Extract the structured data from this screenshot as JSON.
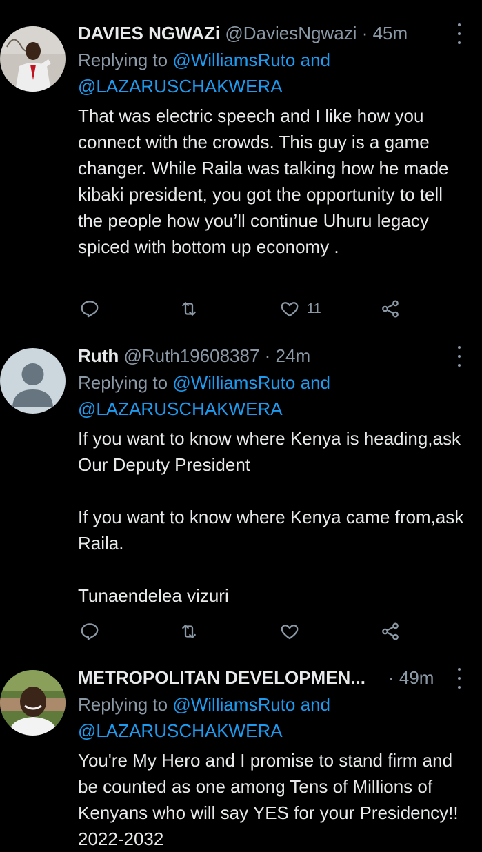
{
  "tweets": [
    {
      "name": "DAVIES NGWAZi",
      "handle": "@DaviesNgwazi",
      "time": "· 45m",
      "replying_prefix": "Replying to ",
      "replying_line1": "@WilliamsRuto and",
      "replying_line2": "@LAZARUSCHAKWERA",
      "text": "That was electric speech and I like how you connect with the crowds. This guy is a game changer. While Raila was talking how he made kibaki president, you got the opportunity to tell the people how you’ll continue Uhuru legacy spiced with bottom up economy .",
      "like_count": "11",
      "avatar_icon": "person-photo-red-white-suit"
    },
    {
      "name": "Ruth",
      "handle": "@Ruth19608387",
      "time": "· 24m",
      "replying_prefix": "Replying to ",
      "replying_line1": "@WilliamsRuto and",
      "replying_line2": "@LAZARUSCHAKWERA",
      "text": "If you want to know where Kenya is heading,ask Our Deputy President\n\nIf you want to know where Kenya came from,ask Raila.\n\nTunaendelea vizuri",
      "like_count": "",
      "avatar_icon": "default-profile-icon"
    },
    {
      "name": "METROPOLITAN DEVELOPMEN...",
      "handle": "",
      "time": "· 49m",
      "replying_prefix": "Replying to ",
      "replying_line1": "@WilliamsRuto and",
      "replying_line2": "@LAZARUSCHAKWERA",
      "text": "You're My Hero and I promise to stand firm and be counted as one among Tens of Millions of Kenyans who will say YES for your Presidency!! 2022-2032",
      "like_count": "",
      "avatar_icon": "person-photo-outdoor"
    }
  ],
  "colors": {
    "background": "#000000",
    "text": "#e7e9ea",
    "muted": "#8b98a5",
    "link": "#1d9bf0",
    "divider": "#2f3336"
  },
  "icons": [
    "reply-icon",
    "retweet-icon",
    "like-icon",
    "share-icon",
    "more-icon"
  ]
}
